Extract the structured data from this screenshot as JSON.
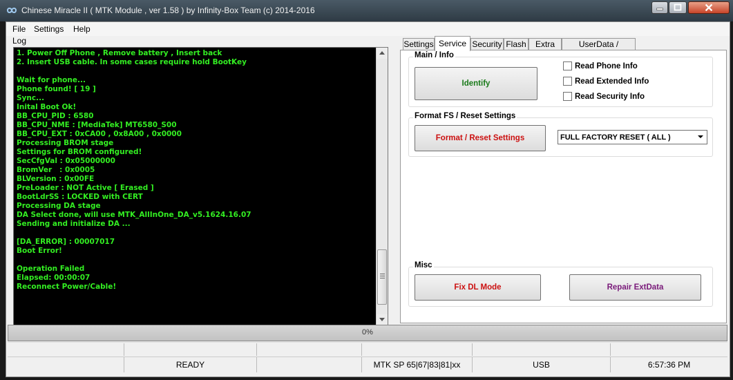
{
  "window": {
    "title": "Chinese Miracle II ( MTK Module , ver 1.58 ) by Infinity-Box Team (c) 2014-2016",
    "app_icon": "infinity-icon"
  },
  "menu": [
    "File",
    "Settings",
    "Help"
  ],
  "log": {
    "label": "Log",
    "lines": [
      "1. Power Off Phone , Remove battery , Insert back",
      "2. Insert USB cable. In some cases require hold BootKey",
      "",
      "Wait for phone...",
      "Phone found! [ 19 ]",
      "Sync...",
      "Inital Boot Ok!",
      "BB_CPU_PID : 6580",
      "BB_CPU_NME : [MediaTek] MT6580_S00",
      "BB_CPU_EXT : 0xCA00 , 0x8A00 , 0x0000",
      "Processing BROM stage",
      "Settings for BROM configured!",
      "SecCfgVal : 0x05000000",
      "BromVer   : 0x0005",
      "BLVersion : 0x00FE",
      "PreLoader : NOT Active [ Erased ]",
      "BootLdrSS : LOCKED with CERT",
      "Processing DA stage",
      "DA Select done, will use MTK_AllInOne_DA_v5.1624.16.07",
      "Sending and initialize DA ...",
      "",
      "[DA_ERROR] : 00007017",
      "Boot Error!",
      "",
      "Operation Failed",
      "Elapsed: 00:00:07",
      "Reconnect Power/Cable!"
    ]
  },
  "tabs": [
    "Settings",
    "Service",
    "Security",
    "Flash",
    "Extra",
    "UserData / Forensic"
  ],
  "active_tab": "Service",
  "service": {
    "main_info": {
      "title": "Main / Info",
      "identify_label": "Identify",
      "checkboxes": [
        "Read Phone Info",
        "Read Extended Info",
        "Read Security Info"
      ]
    },
    "format": {
      "title": "Format FS / Reset Settings",
      "button_label": "Format / Reset Settings",
      "selected_option": "FULL FACTORY RESET ( ALL )"
    },
    "misc": {
      "title": "Misc",
      "fix_dl_label": "Fix DL Mode",
      "repair_label": "Repair ExtData"
    }
  },
  "progress": {
    "text": "0%",
    "percent": 0
  },
  "status": {
    "state": "READY",
    "platform": "MTK SP 65|67|83|81|xx",
    "connection": "USB",
    "time": "6:57:36 PM"
  },
  "colors": {
    "log_text": "#33ee22",
    "identify": "#1a7a1a",
    "format": "#cc1111",
    "fix_dl": "#cc1111",
    "repair": "#7a1a7a"
  }
}
